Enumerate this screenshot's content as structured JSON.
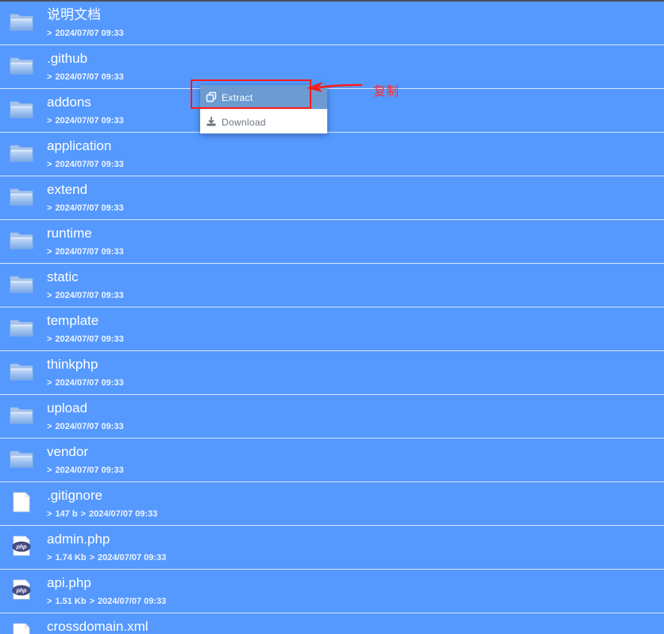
{
  "files": [
    {
      "name": "说明文档",
      "type": "folder",
      "date": "2024/07/07 09:33"
    },
    {
      "name": ".github",
      "type": "folder",
      "date": "2024/07/07 09:33"
    },
    {
      "name": "addons",
      "type": "folder",
      "date": "2024/07/07 09:33"
    },
    {
      "name": "application",
      "type": "folder",
      "date": "2024/07/07 09:33"
    },
    {
      "name": "extend",
      "type": "folder",
      "date": "2024/07/07 09:33"
    },
    {
      "name": "runtime",
      "type": "folder",
      "date": "2024/07/07 09:33"
    },
    {
      "name": "static",
      "type": "folder",
      "date": "2024/07/07 09:33"
    },
    {
      "name": "template",
      "type": "folder",
      "date": "2024/07/07 09:33"
    },
    {
      "name": "thinkphp",
      "type": "folder",
      "date": "2024/07/07 09:33"
    },
    {
      "name": "upload",
      "type": "folder",
      "date": "2024/07/07 09:33"
    },
    {
      "name": "vendor",
      "type": "folder",
      "date": "2024/07/07 09:33"
    },
    {
      "name": ".gitignore",
      "type": "file",
      "size": "147 b",
      "date": "2024/07/07 09:33"
    },
    {
      "name": "admin.php",
      "type": "php",
      "size": "1.74 Kb",
      "date": "2024/07/07 09:33"
    },
    {
      "name": "api.php",
      "type": "php",
      "size": "1.51 Kb",
      "date": "2024/07/07 09:33"
    },
    {
      "name": "crossdomain.xml",
      "type": "file",
      "size": "",
      "date": ""
    }
  ],
  "separator": ">",
  "context_menu": {
    "items": [
      {
        "label": "Extract",
        "icon": "copy-icon",
        "active": true
      },
      {
        "label": "Download",
        "icon": "download-icon",
        "active": false
      }
    ]
  },
  "annotation": {
    "text": "复制",
    "color": "#ff1a1a"
  },
  "colors": {
    "row_background": "#5599ff",
    "row_divider": "#d6e6ff",
    "menu_active": "#6c9bd2",
    "menu_text": "#6c7480"
  }
}
